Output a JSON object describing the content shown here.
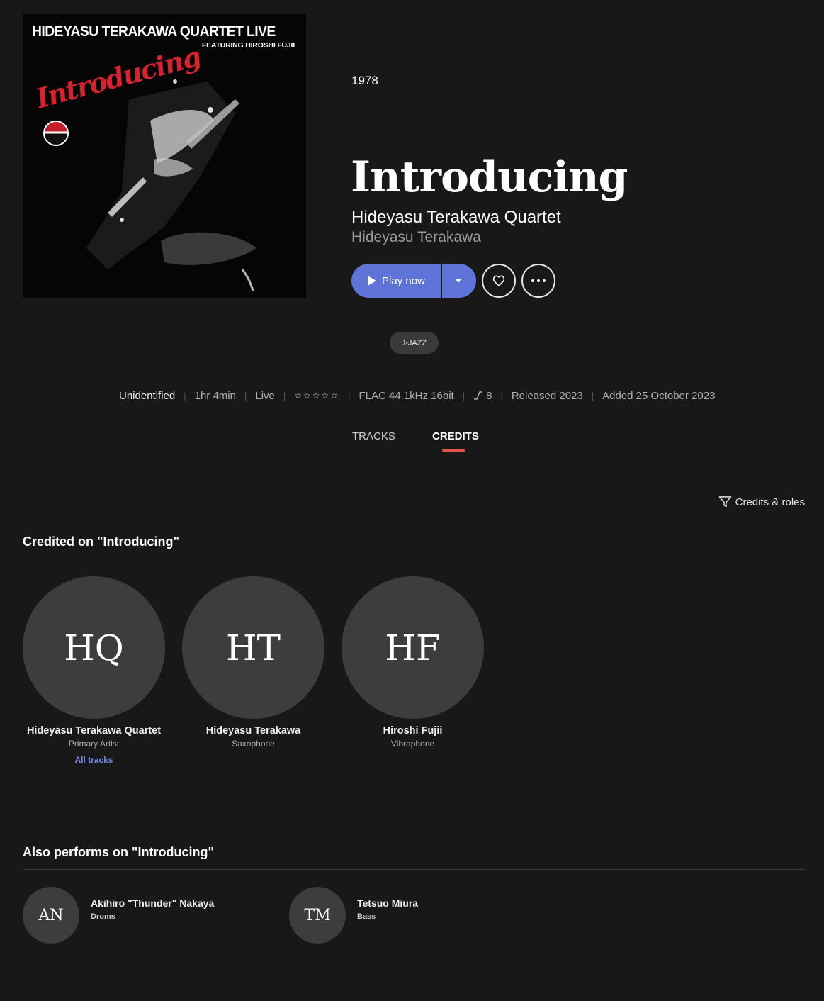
{
  "cover": {
    "title": "HIDEYASU TERAKAWA QUARTET LIVE",
    "subtitle": "FEATURING HIROSHI FUJII",
    "script": "Introducing"
  },
  "album": {
    "year": "1978",
    "title": "Introducing",
    "artist": "Hideyasu Terakawa Quartet",
    "secondary_artist": "Hideyasu Terakawa"
  },
  "actions": {
    "play_label": "Play now"
  },
  "genre": "J-JAZZ",
  "meta": {
    "status": "Unidentified",
    "duration": "1hr 4min",
    "type": "Live",
    "stars": "☆☆☆☆☆",
    "format": "FLAC 44.1kHz 16bit",
    "track_count": "8",
    "released": "Released 2023",
    "added": "Added 25 October 2023"
  },
  "tabs": {
    "tracks": "TRACKS",
    "credits": "CREDITS",
    "active": "CREDITS"
  },
  "filter_label": "Credits & roles",
  "credited": {
    "title": "Credited on \"Introducing\"",
    "items": [
      {
        "initials": "HQ",
        "name": "Hideyasu Terakawa Quartet",
        "role": "Primary Artist",
        "link": "All tracks"
      },
      {
        "initials": "HT",
        "name": "Hideyasu Terakawa",
        "role": "Saxophone"
      },
      {
        "initials": "HF",
        "name": "Hiroshi Fujii",
        "role": "Vibraphone"
      }
    ]
  },
  "also": {
    "title": "Also performs on \"Introducing\"",
    "items": [
      {
        "initials": "AN",
        "name": "Akihiro \"Thunder\" Nakaya",
        "role": "Drums"
      },
      {
        "initials": "TM",
        "name": "Tetsuo Miura",
        "role": "Bass"
      }
    ]
  },
  "colors": {
    "accent": "#5f74d8",
    "tab_underline": "#e5554a",
    "link": "#7088ec",
    "background": "#181818"
  }
}
